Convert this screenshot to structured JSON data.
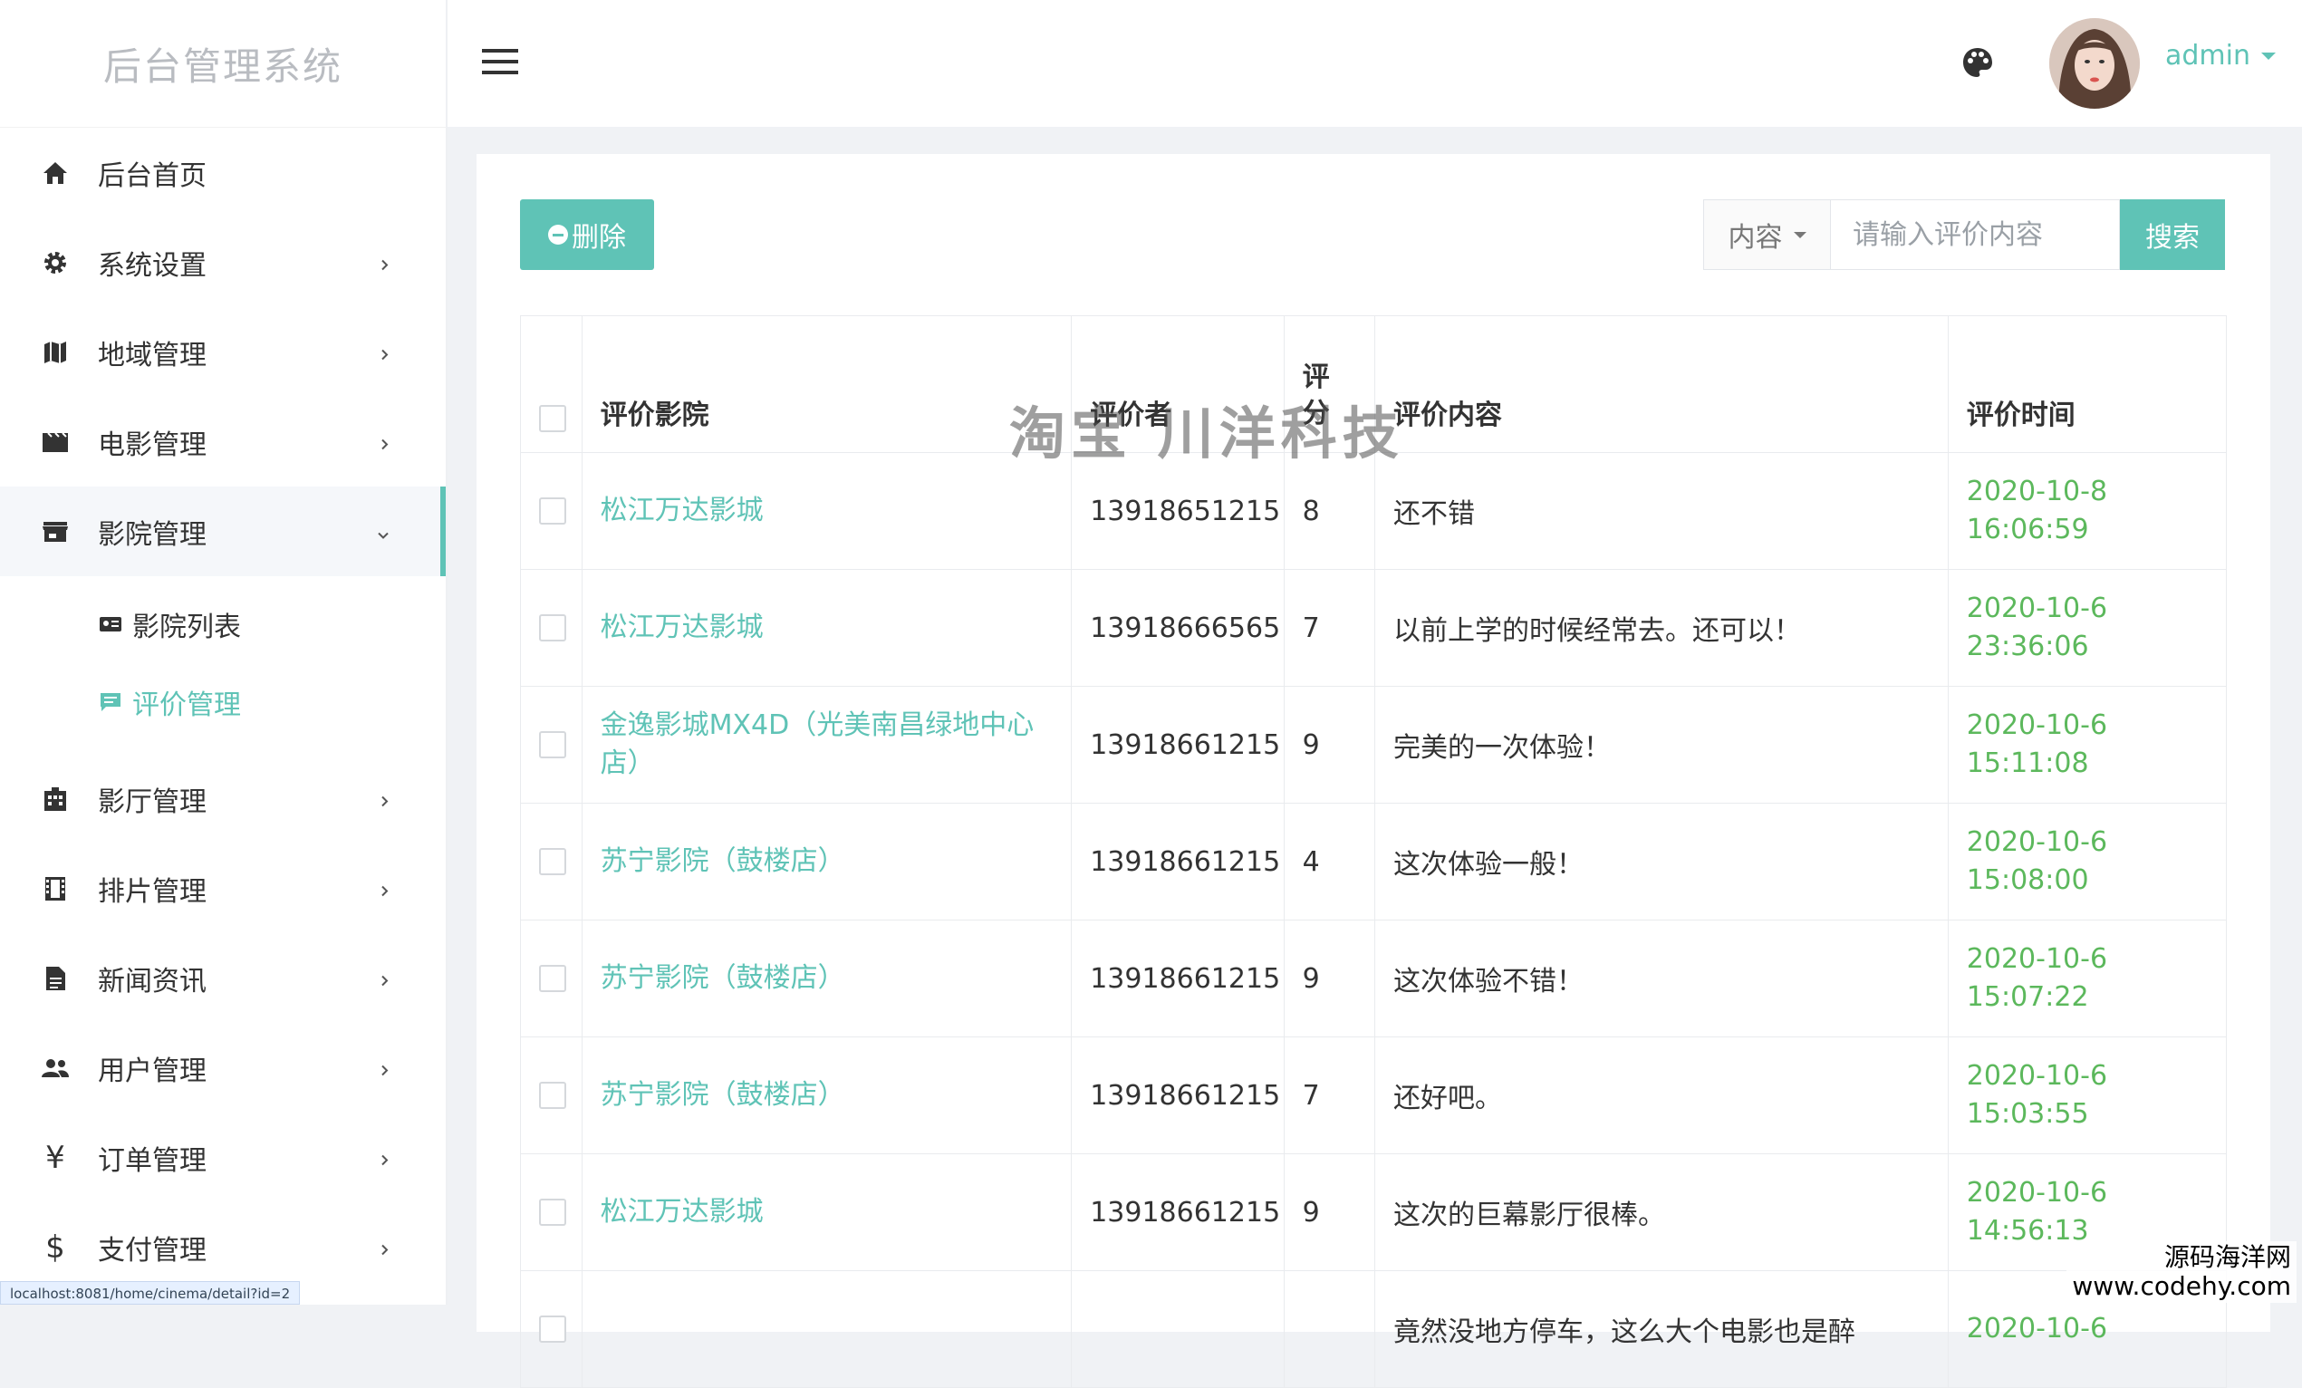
{
  "app": {
    "brand": "后台管理系统"
  },
  "sidebar": {
    "items": [
      {
        "label": "后台首页",
        "icon": "home-icon"
      },
      {
        "label": "系统设置",
        "icon": "gear-icon"
      },
      {
        "label": "地域管理",
        "icon": "map-icon"
      },
      {
        "label": "电影管理",
        "icon": "film-icon"
      },
      {
        "label": "影院管理",
        "icon": "store-icon",
        "active": true
      },
      {
        "label": "影厅管理",
        "icon": "building-icon"
      },
      {
        "label": "排片管理",
        "icon": "film-strip-icon"
      },
      {
        "label": "新闻资讯",
        "icon": "news-icon"
      },
      {
        "label": "用户管理",
        "icon": "users-icon"
      },
      {
        "label": "订单管理",
        "icon": "yen-icon"
      },
      {
        "label": "支付管理",
        "icon": "dollar-icon"
      }
    ],
    "submenu": [
      {
        "label": "影院列表",
        "icon": "id-card-icon"
      },
      {
        "label": "评价管理",
        "icon": "comment-icon",
        "current": true
      }
    ]
  },
  "header": {
    "user": "admin"
  },
  "toolbar": {
    "delete_label": "删除",
    "search_field": "内容",
    "search_placeholder": "请输入评价内容",
    "search_label": "搜索"
  },
  "table": {
    "columns": {
      "cinema": "评价影院",
      "user": "评价者",
      "score": "评分",
      "content": "评价内容",
      "time": "评价时间"
    },
    "rows": [
      {
        "cinema": "松江万达影城",
        "user": "13918651215",
        "score": "8",
        "content": "还不错",
        "date": "2020-10-8",
        "time": "16:06:59"
      },
      {
        "cinema": "松江万达影城",
        "user": "13918666565",
        "score": "7",
        "content": "以前上学的时候经常去。还可以！",
        "date": "2020-10-6",
        "time": "23:36:06"
      },
      {
        "cinema": "金逸影城MX4D（光美南昌绿地中心店）",
        "user": "13918661215",
        "score": "9",
        "content": "完美的一次体验！",
        "date": "2020-10-6",
        "time": "15:11:08"
      },
      {
        "cinema": "苏宁影院（鼓楼店）",
        "user": "13918661215",
        "score": "4",
        "content": "这次体验一般！",
        "date": "2020-10-6",
        "time": "15:08:00"
      },
      {
        "cinema": "苏宁影院（鼓楼店）",
        "user": "13918661215",
        "score": "9",
        "content": "这次体验不错！",
        "date": "2020-10-6",
        "time": "15:07:22"
      },
      {
        "cinema": "苏宁影院（鼓楼店）",
        "user": "13918661215",
        "score": "7",
        "content": "还好吧。",
        "date": "2020-10-6",
        "time": "15:03:55"
      },
      {
        "cinema": "松江万达影城",
        "user": "13918661215",
        "score": "9",
        "content": "这次的巨幕影厅很棒。",
        "date": "2020-10-6",
        "time": "14:56:13"
      },
      {
        "cinema": "",
        "user": "",
        "score": "",
        "content": "竟然没地方停车，这么大个电影也是醉",
        "date": "2020-10-6",
        "time": ""
      }
    ]
  },
  "status_url": "localhost:8081/home/cinema/detail?id=2",
  "watermark": {
    "center": "淘宝 川洋科技",
    "corner_line1": "源码海洋网",
    "corner_line2": "www.codehy.com"
  },
  "colors": {
    "accent": "#5fc3b6",
    "time_green": "#5cb85c"
  }
}
